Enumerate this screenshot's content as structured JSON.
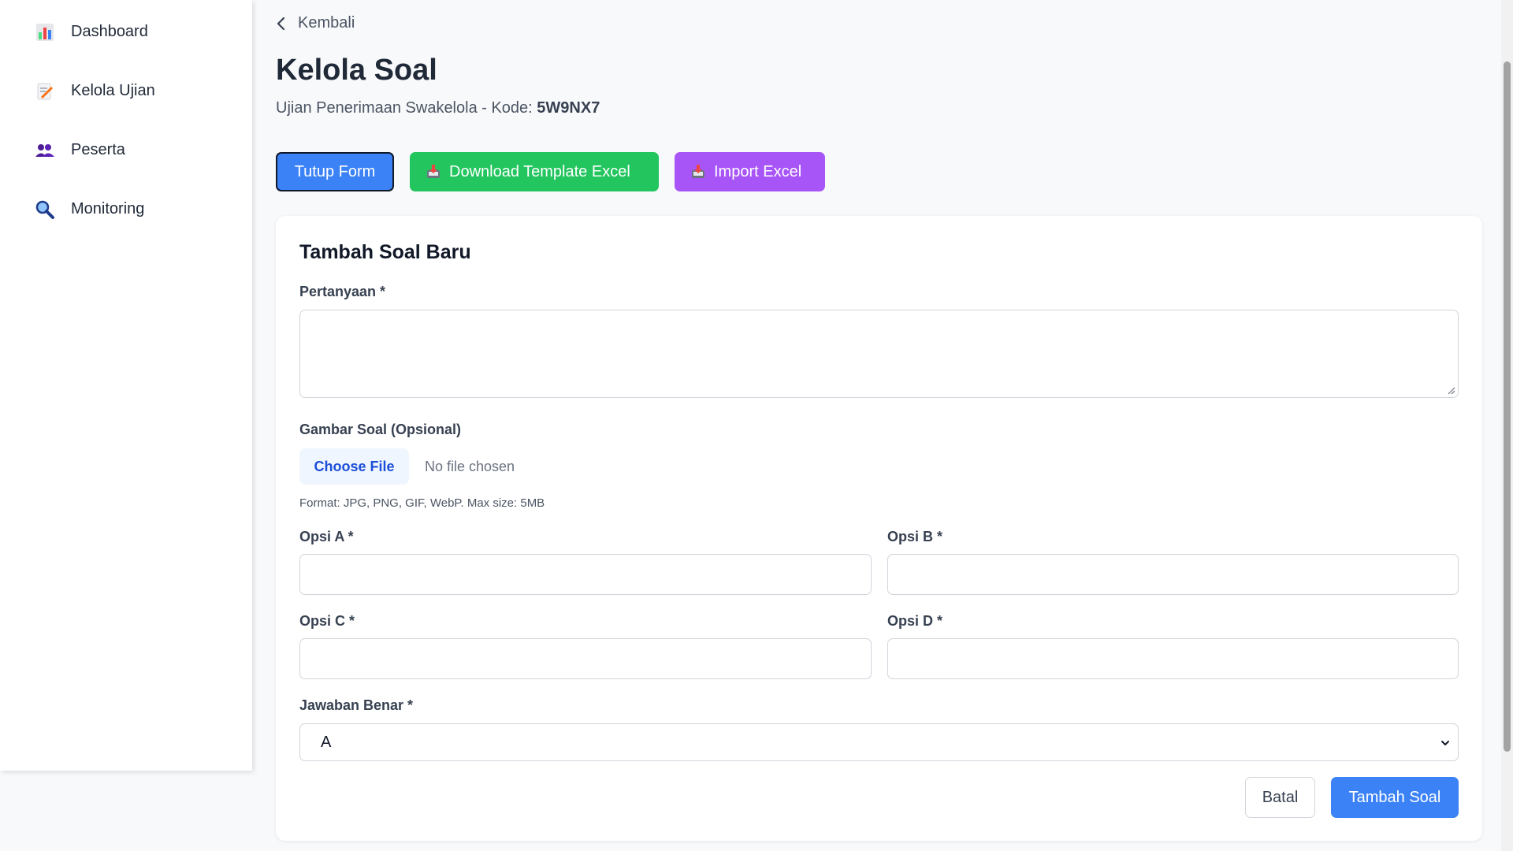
{
  "sidebar": {
    "items": [
      {
        "label": "Dashboard",
        "icon": "bar-chart-icon"
      },
      {
        "label": "Kelola Ujian",
        "icon": "memo-icon"
      },
      {
        "label": "Peserta",
        "icon": "users-icon"
      },
      {
        "label": "Monitoring",
        "icon": "magnifier-icon"
      }
    ]
  },
  "header": {
    "back_label": "Kembali",
    "title": "Kelola Soal",
    "subtitle_prefix": "Ujian Penerimaan Swakelola - Kode: ",
    "exam_code": "5W9NX7"
  },
  "actions": {
    "close_form": "Tutup Form",
    "download_template": "Download Template Excel",
    "import_excel": "Import Excel"
  },
  "form": {
    "title": "Tambah Soal Baru",
    "question_label": "Pertanyaan *",
    "question_value": "",
    "image_label": "Gambar Soal (Opsional)",
    "choose_file": "Choose File",
    "file_status": "No file chosen",
    "file_hint": "Format: JPG, PNG, GIF, WebP. Max size: 5MB",
    "options": [
      {
        "label": "Opsi A *",
        "value": ""
      },
      {
        "label": "Opsi B *",
        "value": ""
      },
      {
        "label": "Opsi C *",
        "value": ""
      },
      {
        "label": "Opsi D *",
        "value": ""
      }
    ],
    "answer_label": "Jawaban Benar *",
    "answer_value": "A",
    "cancel": "Batal",
    "submit": "Tambah Soal"
  },
  "colors": {
    "primary": "#3b82f6",
    "success": "#22c55e",
    "purple": "#a855f7",
    "background": "#f8f9fb"
  }
}
